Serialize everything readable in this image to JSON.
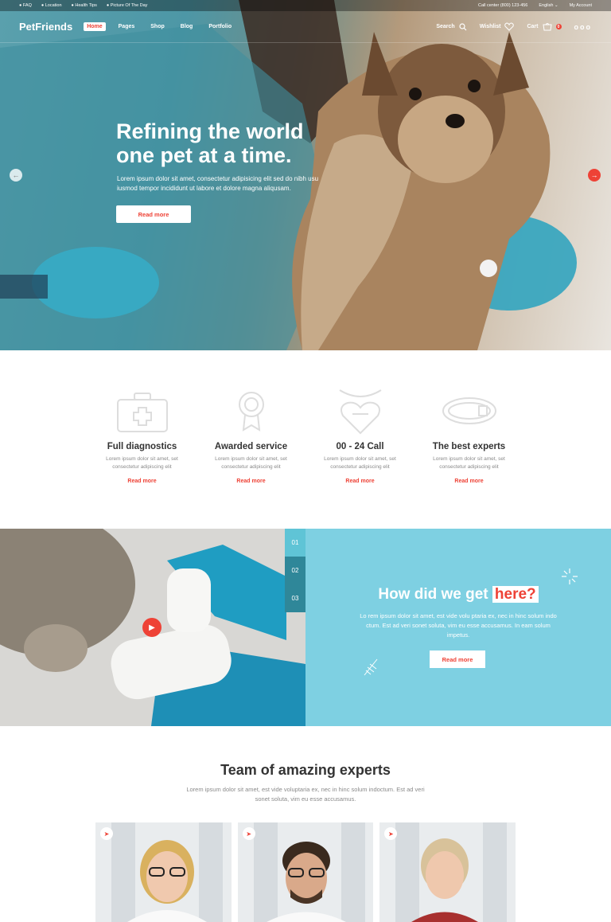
{
  "topbar": {
    "faq": "FAQ",
    "location": "Location",
    "health_tips": "Health Tips",
    "picture_of_day": "Picture Of The Day",
    "call_center": "Call center (800) 123-456",
    "language": "English",
    "my_account": "My Account"
  },
  "nav": {
    "logo": "PetFriends",
    "menu": [
      "Home",
      "Pages",
      "Shop",
      "Blog",
      "Portfolio"
    ],
    "search": "Search",
    "wishlist": "Wishlist",
    "cart": "Cart",
    "cart_count": "0",
    "more": "ooo"
  },
  "hero": {
    "title": "Refining the world one pet at a time.",
    "text": "Lorem ipsum dolor sit amet, consectetur adipisicing elit sed do nibh usu iusmod tempor incididunt ut labore et dolore magna aliqusam.",
    "button": "Read more"
  },
  "features": [
    {
      "icon": "first-aid-kit-icon",
      "title": "Full diagnostics",
      "desc": "Lorem ipsum dolor sit amet, set consectetur adipiscing elit",
      "more": "Read more"
    },
    {
      "icon": "award-medal-icon",
      "title": "Awarded service",
      "desc": "Lorem ipsum dolor sit amet, set consectetur adipiscing elit",
      "more": "Read more"
    },
    {
      "icon": "heart-tag-icon",
      "title": "00 - 24 Call",
      "desc": "Lorem ipsum dolor sit amet, set consectetur adipiscing elit",
      "more": "Read more"
    },
    {
      "icon": "pet-collar-icon",
      "title": "The best experts",
      "desc": "Lorem ipsum dolor sit amet, set consectetur adipiscing elit",
      "more": "Read more"
    }
  ],
  "how": {
    "tabs": [
      "01",
      "02",
      "03"
    ],
    "title_main": "How did we get",
    "title_highlight": "here?",
    "text": "Lo rem ipsum dolor sit amet, est vide volu ptaria ex, nec in hinc solum indo ctum. Est ad veri sonet soluta, vim eu esse accusamus. In eam solum impetus.",
    "button": "Read more"
  },
  "team": {
    "title": "Team of amazing experts",
    "text": "Lorem ipsum dolor sit amet, est vide voluptaria ex, nec in hinc solum indoctum. Est ad veri sonet soluta, vim eu esse accusamus."
  },
  "colors": {
    "accent": "#ee4236",
    "panel": "#7ed0e2",
    "tab_dark": "#2f8799"
  }
}
